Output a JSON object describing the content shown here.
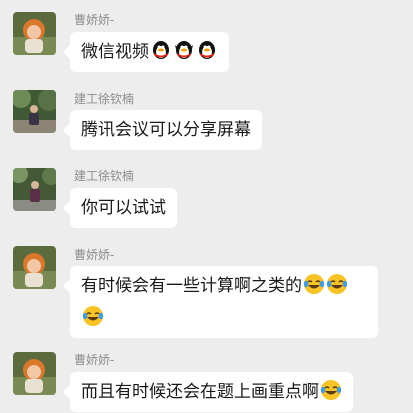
{
  "messages": [
    {
      "sender": "曹娇娇-",
      "text": "微信视频",
      "emojis": [
        "qq-penguin-emoji",
        "qq-penguin-emoji",
        "qq-penguin-emoji"
      ]
    },
    {
      "sender": "建工徐钦楠",
      "text": "腾讯会议可以分享屏幕",
      "emojis": []
    },
    {
      "sender": "建工徐钦楠",
      "text": "你可以试试",
      "emojis": []
    },
    {
      "sender": "曹娇娇-",
      "text": "有时候会有一些计算啊之类的",
      "emojis": [
        "laugh-cry-emoji",
        "laugh-cry-emoji",
        "laugh-cry-emoji"
      ]
    },
    {
      "sender": "曹娇娇-",
      "text": "而且有时候还会在题上画重点啊",
      "emojis": [
        "laugh-cry-emoji"
      ]
    }
  ],
  "colors": {
    "background": "#ededed",
    "bubble": "#ffffff",
    "sender_name": "#8d8d8d",
    "text": "#191919"
  }
}
